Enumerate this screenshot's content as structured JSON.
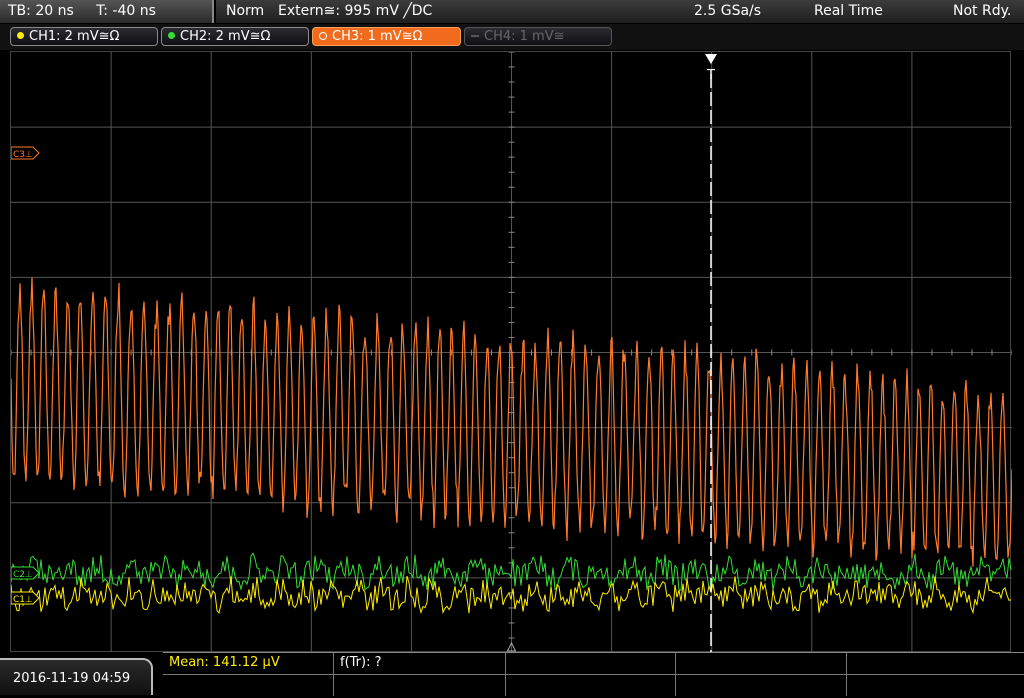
{
  "topbar": {
    "timebase": "TB: 20 ns",
    "trigger_time": "T: -40 ns",
    "mode": "Norm",
    "trigger_source": "Extern≅: 995 mV ╱DC",
    "sample_rate": "2.5 GSa/s",
    "acq_mode": "Real Time",
    "status": "Not Rdy."
  },
  "channels": [
    {
      "label": "CH1: 2 mV≅Ω",
      "color": "#ffee00",
      "state": "on"
    },
    {
      "label": "CH2: 2 mV≅Ω",
      "color": "#33dd33",
      "state": "on"
    },
    {
      "label": "CH3: 1 mV≅Ω",
      "color": "#ff7a2a",
      "state": "active"
    },
    {
      "label": "CH4: 1 mV≅",
      "color": "#666666",
      "state": "off"
    }
  ],
  "markers": {
    "trigger": "T",
    "ch3_ref": "C3⊥",
    "ch2_ref": "C2⊥",
    "ch1_ref": "C1⊥"
  },
  "bottombar": {
    "datetime": "2016-11-19  04:59",
    "measurement_1": "Mean: 141.12 µV",
    "measurement_2": "f(Tr): ?"
  },
  "colors": {
    "ch1": "#ffee00",
    "ch2": "#33dd33",
    "ch3": "#ff7a2a",
    "grid": "#555555",
    "trigger_line": "#ffffff"
  }
}
